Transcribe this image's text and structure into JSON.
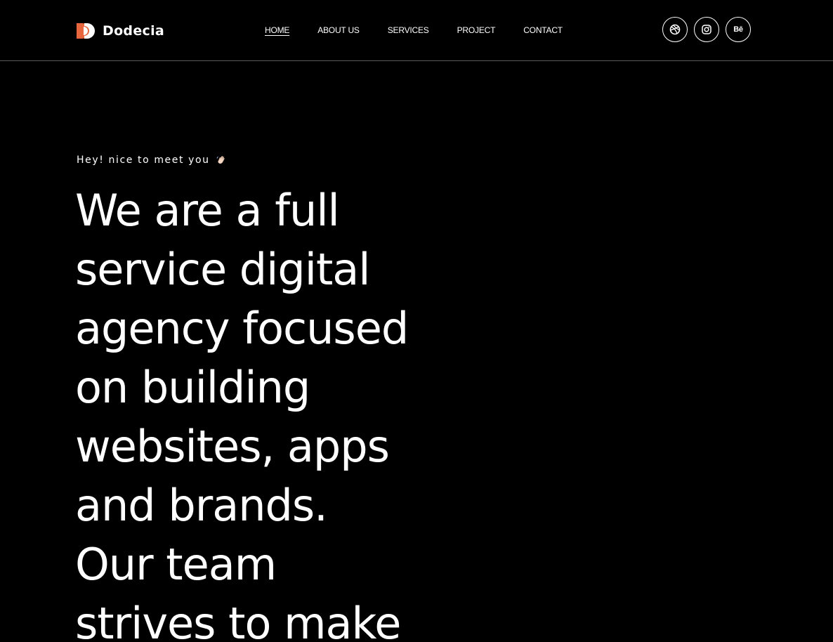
{
  "brand": {
    "name": "Dodecia",
    "accent_color": "#E8663D"
  },
  "nav": {
    "items": [
      {
        "label": "HOME",
        "active": true
      },
      {
        "label": "ABOUT US",
        "active": false
      },
      {
        "label": "SERVICES",
        "active": false
      },
      {
        "label": "PROJECT",
        "active": false
      },
      {
        "label": "CONTACT",
        "active": false
      }
    ]
  },
  "socials": {
    "dribbble_icon": "dribbble-icon",
    "instagram_icon": "instagram-icon",
    "behance_label": "Bē"
  },
  "hero": {
    "greeting": "Hey! nice to meet you",
    "greeting_icon": "waving-hand-icon",
    "headline_lines": [
      "We are a full",
      "service digital",
      "agency focused",
      "on building",
      "websites, apps",
      "and brands.",
      "Our team",
      "strives to make"
    ]
  }
}
